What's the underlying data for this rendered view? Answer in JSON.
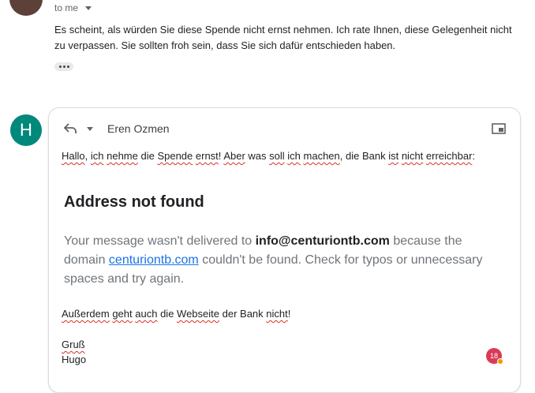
{
  "message": {
    "to_label": "to me",
    "body_line1": "Es scheint, als würden Sie diese Spende nicht ernst nehmen. Ich rate Ihnen, diese Gelegenheit nicht",
    "body_line2": "zu verpassen. Sie sollten froh sein, dass Sie sich dafür entschieden haben."
  },
  "reply": {
    "avatar_letter": "H",
    "recipient": "Eren Ozmen",
    "p1": {
      "w1": "Hallo",
      "s1": ", ",
      "w2": "ich",
      "s2": " ",
      "w3": "nehme",
      "s3": " die ",
      "w4": "Spende",
      "s4": " ",
      "w5": "ernst",
      "s5": "! ",
      "w6": "Aber",
      "s6": " was ",
      "w7": "soll",
      "s7": " ",
      "w8": "ich",
      "s8": " ",
      "w9": "machen",
      "s9": ", die Bank ",
      "w10": "ist",
      "s10": " ",
      "w11": "nicht",
      "s11": " ",
      "w12": "erreichbar",
      "s12": ":"
    },
    "heading": "Address not found",
    "nf": {
      "t1": "Your message wasn't delivered to ",
      "email": "info@centuriontb.com",
      "t2": " because the domain ",
      "domain": "centuriontb.com",
      "t3": " couldn't be found. Check for typos or unnecessary spaces and try again."
    },
    "p2": {
      "w1": "Außerdem",
      "s1": " ",
      "w2": "geht",
      "s2": " ",
      "w3": "auch",
      "s3": " die ",
      "w4": "Webseite",
      "s4": " der Bank ",
      "w5": "nicht",
      "s5": "!"
    },
    "greeting": "Gruß",
    "signature": "Hugo"
  },
  "badge": {
    "count": "18"
  }
}
